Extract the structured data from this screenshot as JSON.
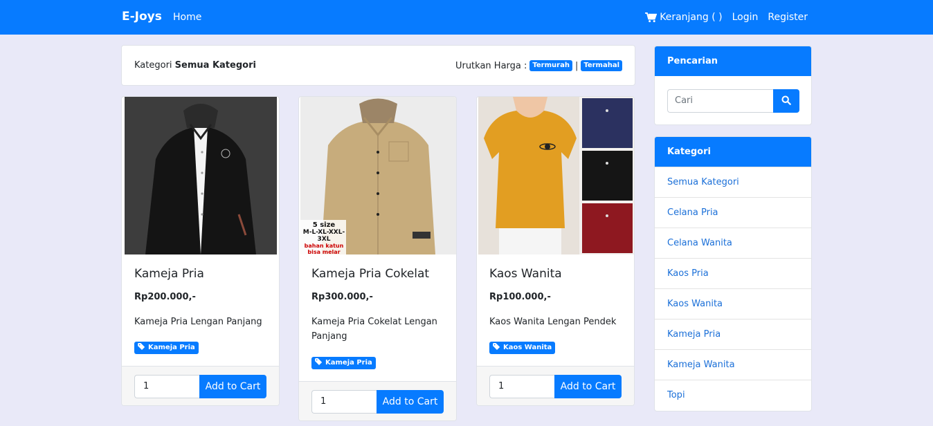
{
  "navbar": {
    "brand": "E-Joys",
    "home": "Home",
    "cart": "Keranjang ( )",
    "login": "Login",
    "register": "Register"
  },
  "filter": {
    "kategori_label": "Kategori",
    "kategori_value": "Semua Kategori",
    "sort_label": "Urutkan Harga :",
    "cheapest": "Termurah",
    "separator": "|",
    "expensive": "Termahal"
  },
  "products": [
    {
      "title": "Kameja Pria",
      "price": "Rp200.000,-",
      "desc": "Kameja Pria Lengan Panjang",
      "tag": "Kameja Pria",
      "qty": "1",
      "button": "Add to Cart"
    },
    {
      "title": "Kameja Pria Cokelat",
      "price": "Rp300.000,-",
      "desc": "Kameja Pria Cokelat Lengan Panjang",
      "tag": "Kameja Pria",
      "qty": "1",
      "button": "Add to Cart",
      "image_text": {
        "line1": "5 size",
        "line2": "M-L-XL-XXL-3XL",
        "line3": "bahan katun",
        "line4": "bisa melar"
      }
    },
    {
      "title": "Kaos Wanita",
      "price": "Rp100.000,-",
      "desc": "Kaos Wanita Lengan Pendek",
      "tag": "Kaos Wanita",
      "qty": "1",
      "button": "Add to Cart"
    }
  ],
  "search": {
    "header": "Pencarian",
    "placeholder": "Cari"
  },
  "categories": {
    "header": "Kategori",
    "items": [
      "Semua Kategori",
      "Celana Pria",
      "Celana Wanita",
      "Kaos Pria",
      "Kaos Wanita",
      "Kameja Pria",
      "Kameja Wanita",
      "Topi"
    ]
  },
  "colors": {
    "primary": "#077bff",
    "background": "#e9e9f8"
  }
}
